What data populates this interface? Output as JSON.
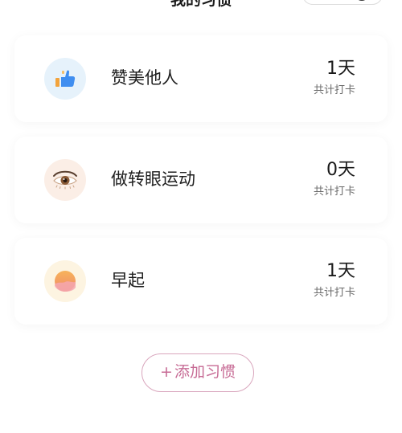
{
  "header": {
    "title": "我的习惯"
  },
  "habits": [
    {
      "name": "赞美他人",
      "days": "1天",
      "caption": "共计打卡",
      "icon": "thumbs-up-icon"
    },
    {
      "name": "做转眼运动",
      "days": "0天",
      "caption": "共计打卡",
      "icon": "eye-icon"
    },
    {
      "name": "早起",
      "days": "1天",
      "caption": "共计打卡",
      "icon": "sunrise-icon"
    }
  ],
  "add_button": {
    "plus": "+",
    "label": "添加习惯"
  },
  "colors": {
    "accent": "#c76b95",
    "accent_border": "#d9a6bd",
    "thumbs_bg": "#e6f2fb",
    "eye_bg": "#fbeee6",
    "sun_bg": "#fdf4e1"
  }
}
